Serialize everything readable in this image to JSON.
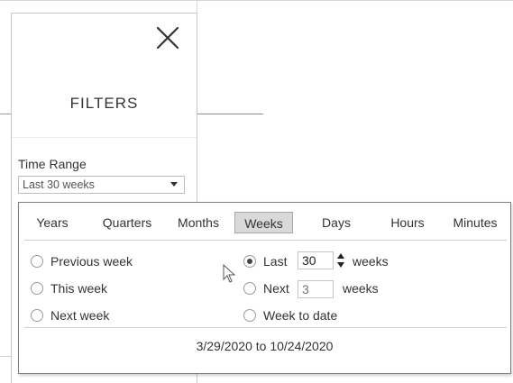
{
  "panel": {
    "title": "FILTERS",
    "close_icon": "close-icon"
  },
  "time_range": {
    "label": "Time Range",
    "selected": "Last 30 weeks"
  },
  "popup": {
    "tabs": [
      {
        "label": "Years",
        "active": false
      },
      {
        "label": "Quarters",
        "active": false
      },
      {
        "label": "Months",
        "active": false
      },
      {
        "label": "Weeks",
        "active": true
      },
      {
        "label": "Days",
        "active": false
      },
      {
        "label": "Hours",
        "active": false
      },
      {
        "label": "Minutes",
        "active": false
      }
    ],
    "left_options": [
      {
        "label": "Previous week",
        "checked": false
      },
      {
        "label": "This week",
        "checked": false
      },
      {
        "label": "Next week",
        "checked": false
      }
    ],
    "last": {
      "label": "Last",
      "checked": true,
      "value": "30",
      "unit": "weeks"
    },
    "next": {
      "label": "Next",
      "checked": false,
      "placeholder": "3",
      "unit": "weeks"
    },
    "week_to_date": {
      "label": "Week to date",
      "checked": false
    },
    "date_range": "3/29/2020 to 10/24/2020"
  }
}
